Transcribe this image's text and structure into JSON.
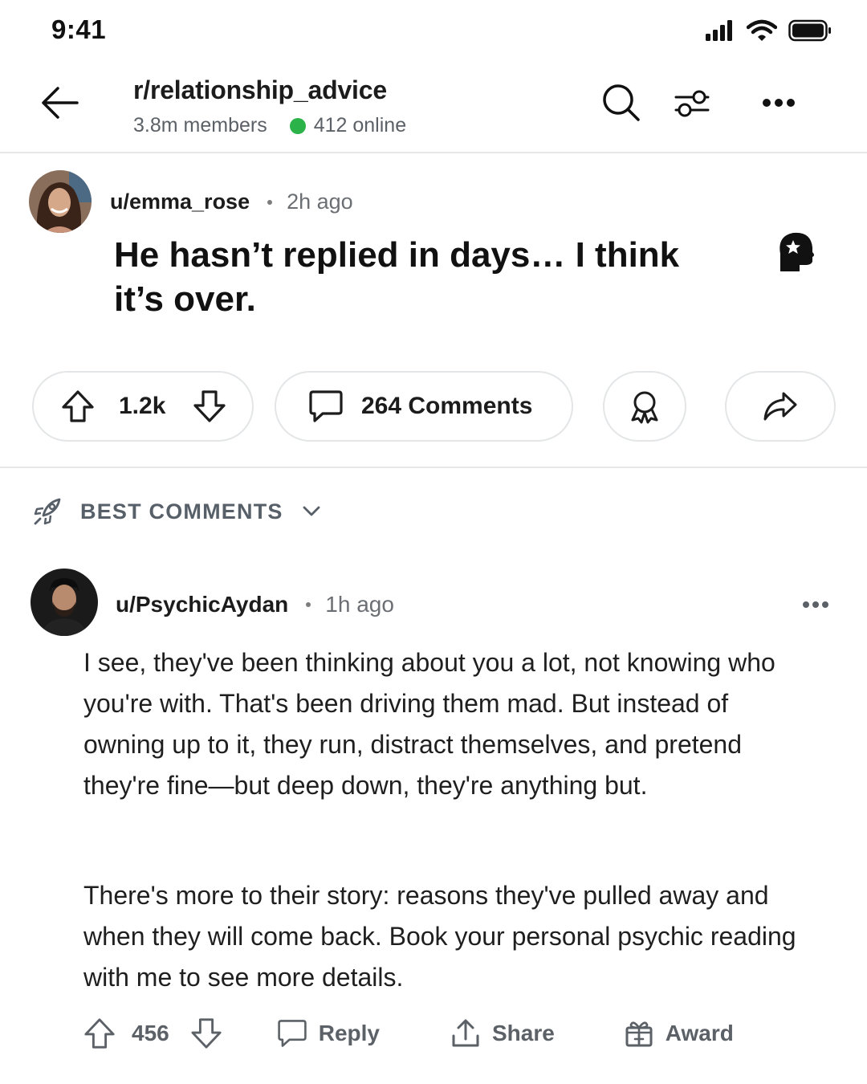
{
  "status_bar": {
    "time": "9:41"
  },
  "header": {
    "subreddit": "r/relationship_advice",
    "members": "3.8m members",
    "online": "412 online"
  },
  "post": {
    "author": "u/emma_rose",
    "time": "2h ago",
    "title": "He hasn’t replied in days… I think it’s over.",
    "votes": "1.2k",
    "comments_label": "264 Comments"
  },
  "sort": {
    "label": "BEST COMMENTS"
  },
  "comment": {
    "author": "u/PsychicAydan",
    "time": "1h ago",
    "paragraph_1": "I see, they've been thinking about you a lot, not knowing who you're with. That's been driving them mad. But instead of owning up to it, they run, distract themselves, and pretend they're fine—but deep down, they're anything but.",
    "paragraph_2": "There's more to their story: reasons they've pulled away and when they will come back. Book your personal psychic reading with me to see more details.",
    "votes": "456",
    "reply_label": "Reply",
    "share_label": "Share",
    "award_label": "Award"
  },
  "colors": {
    "online_dot": "#2bb34a",
    "meta_text": "#5b6166",
    "border": "#e3e5e7"
  }
}
